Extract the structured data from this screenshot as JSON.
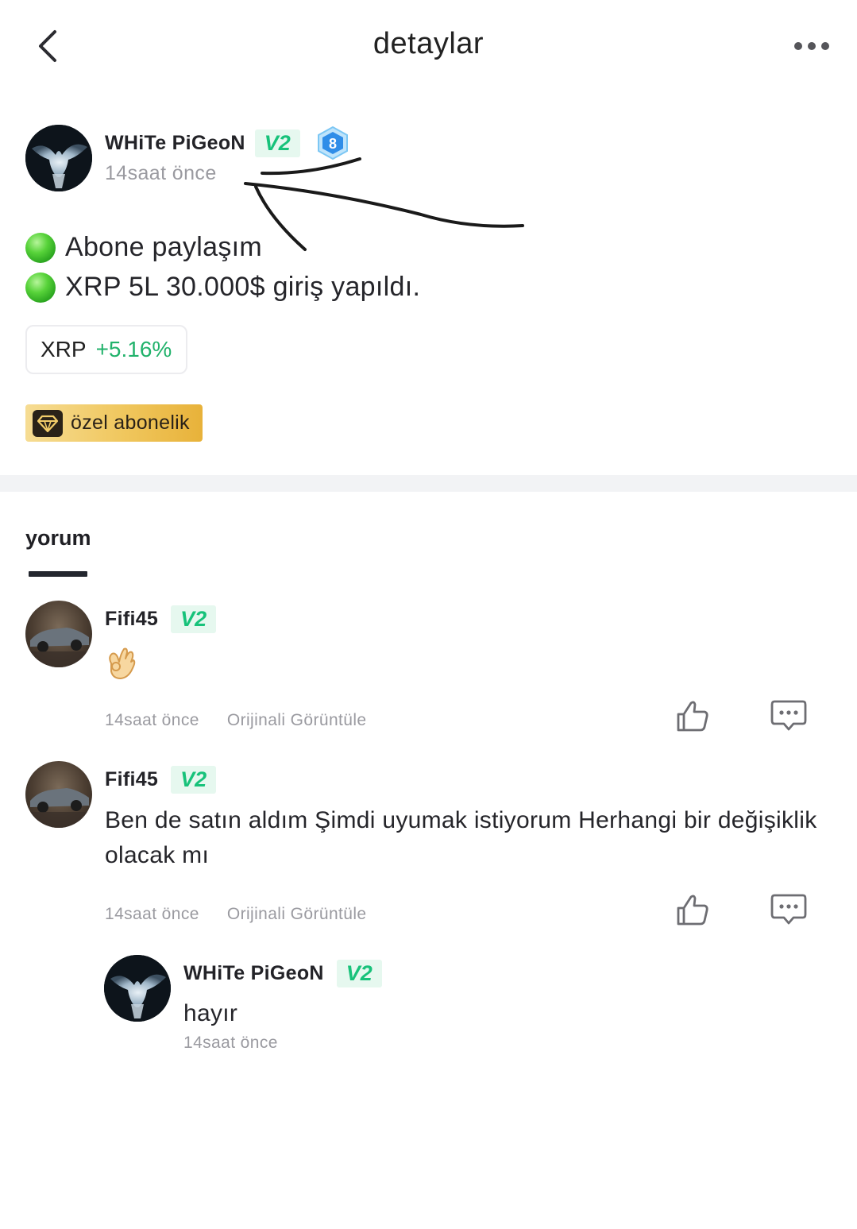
{
  "header": {
    "title": "detaylar",
    "back_icon": "chevron-left-icon",
    "more_icon": "more-horizontal-icon"
  },
  "post": {
    "author": "WHiTe PiGeoN",
    "badge": "V2",
    "level": "8",
    "time": "14saat önce",
    "lines": [
      "Abone paylaşım",
      "XRP 5L 30.000$ giriş yapıldı."
    ],
    "coin": {
      "symbol": "XRP",
      "change": "+5.16%"
    },
    "premium_label": "özel abonelik"
  },
  "comments": {
    "tab_label": "yorum",
    "items": [
      {
        "author": "Fifi45",
        "badge": "V2",
        "text": "",
        "emoji": "ok-hand-emoji",
        "time": "14saat önce",
        "view_original": "Orijinali Görüntüle"
      },
      {
        "author": "Fifi45",
        "badge": "V2",
        "text": "Ben de satın aldım  Şimdi uyumak istiyorum  Herhangi bir değişiklik olacak mı",
        "time": "14saat önce",
        "view_original": "Orijinali Görüntüle"
      }
    ],
    "reply": {
      "author": "WHiTe PiGeoN",
      "badge": "V2",
      "text": "hayır",
      "time": "14saat önce"
    }
  },
  "colors": {
    "accent_green": "#21b26b",
    "badge_green": "#17c27a",
    "premium_gold": "#f0c75e"
  }
}
